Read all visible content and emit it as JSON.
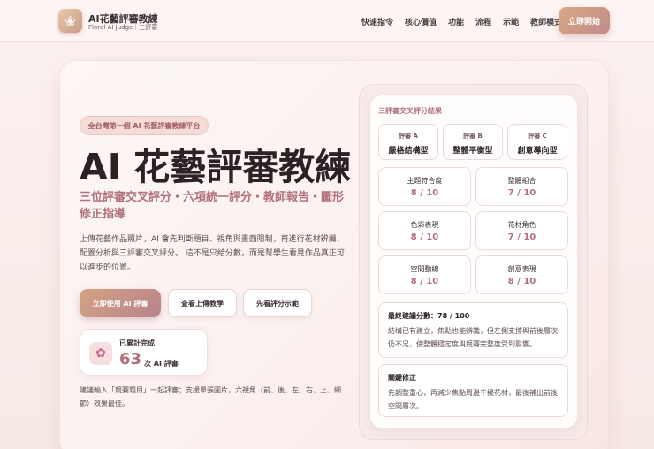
{
  "header": {
    "brand_title": "AI花藝評審教練",
    "brand_sub": "Floral AI Judge｜三評審",
    "nav": [
      "快速指令",
      "核心價值",
      "功能",
      "流程",
      "示範",
      "教師模式"
    ],
    "cta": "立即開始"
  },
  "hero": {
    "pill": "全台灣第一個 AI 花藝評審教練平台",
    "title": "AI 花藝評審教練",
    "subtitle": "三位評審交叉評分・六項統一評分・教師報告・圖形修正指導",
    "description": "上傳花藝作品照片，AI 會先判斷題目、視角與畫面限制，再進行花材辨識、配置分析與三評審交叉評分。 這不是只給分數，而是幫學生看見作品真正可以進步的位置。",
    "buttons": {
      "primary": "立即使用 AI 評審",
      "howto": "查看上傳教學",
      "demo": "先看評分示範"
    },
    "counter": {
      "label": "已累計完成",
      "number": "63",
      "unit": "次 AI 評審"
    },
    "tip": "建議輸入「競賽題目」一起評審；支援單張圖片，六視角（前、後、左、右、上、細節）效果最佳。"
  },
  "panel": {
    "title": "三評審交叉評分結果",
    "judges": [
      {
        "name": "評審 A",
        "type": "嚴格結構型"
      },
      {
        "name": "評審 B",
        "type": "整體平衡型"
      },
      {
        "name": "評審 C",
        "type": "創意導向型"
      }
    ],
    "scores": [
      {
        "label": "主題符合度",
        "value": "8 / 10"
      },
      {
        "label": "整體組合",
        "value": "7 / 10"
      },
      {
        "label": "色彩表現",
        "value": "8 / 10"
      },
      {
        "label": "花材角色",
        "value": "7 / 10"
      },
      {
        "label": "空間動線",
        "value": "8 / 10"
      },
      {
        "label": "創意表現",
        "value": "8 / 10"
      }
    ],
    "final": {
      "title": "最終建議分數：78 / 100",
      "body": "結構已有建立，焦點也能辨識，但左側支撐與前後層次仍不足，使整體穩定度與競賽完整度受到影響。"
    },
    "fix": {
      "title": "關鍵修正",
      "body": "先調整重心，再減少焦點周邊干擾花材，最後補出前後空間層次。"
    }
  }
}
